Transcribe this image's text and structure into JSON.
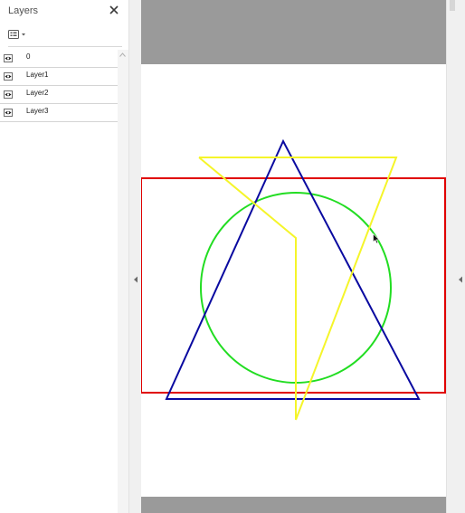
{
  "layers_panel": {
    "title": "Layers",
    "close_icon": "close-icon",
    "options_icon": "layer-options-icon",
    "layers": [
      {
        "name": "0",
        "visible": true
      },
      {
        "name": "Layer1",
        "visible": true
      },
      {
        "name": "Layer2",
        "visible": true
      },
      {
        "name": "Layer3",
        "visible": true
      }
    ]
  },
  "drawing": {
    "shapes": [
      {
        "type": "rectangle",
        "color": "#e00000"
      },
      {
        "type": "circle",
        "color": "#22dd22"
      },
      {
        "type": "triangle",
        "color": "#0a0aa0"
      },
      {
        "type": "inverted-triangle",
        "color": "#f5f52a"
      },
      {
        "type": "line",
        "color": "#f5f52a"
      }
    ]
  },
  "colors": {
    "viewport_background": "#9a9a9a",
    "page_background": "#ffffff"
  }
}
